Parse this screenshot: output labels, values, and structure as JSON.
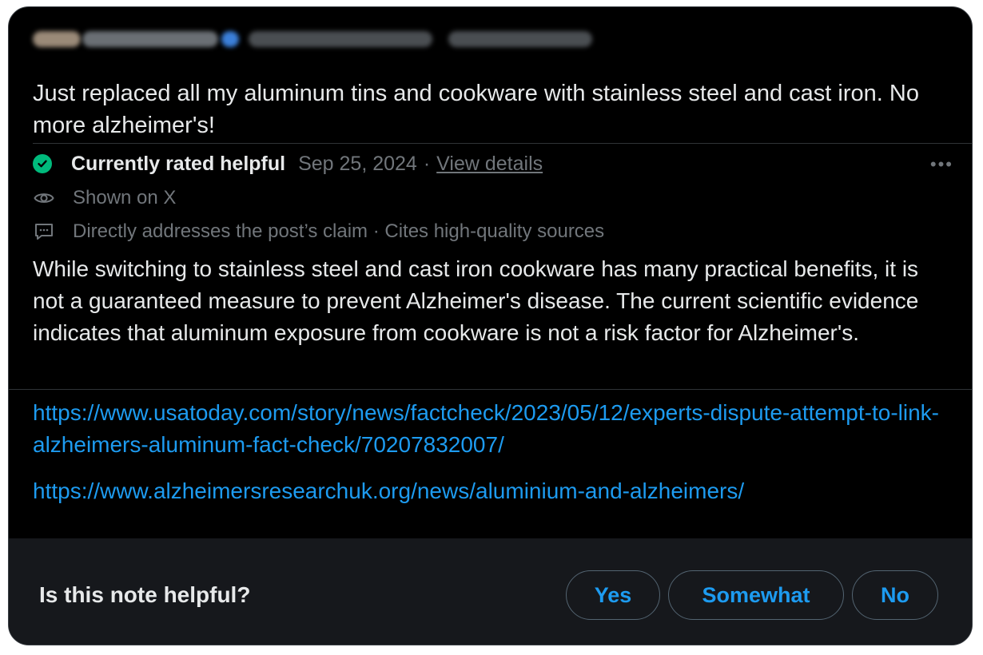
{
  "post": {
    "text": "Just replaced all my aluminum tins and cookware with stainless steel and cast iron. No more alzheimer's!"
  },
  "note": {
    "status": "Currently rated helpful",
    "date": "Sep 25, 2024",
    "separator": "·",
    "details_link": "View details",
    "more_icon": "more-horizontal-icon",
    "shown_on": "Shown on X",
    "qualities": "Directly addresses the post’s claim · Cites high-quality sources",
    "body": "While switching to stainless steel and cast iron cookware has many practical benefits, it is not a guaranteed measure to prevent Alzheimer's disease. The current scientific evidence indicates that aluminum exposure from cookware is not a risk factor for Alzheimer's.",
    "links": [
      "https://www.usatoday.com/story/news/factcheck/2023/05/12/experts-dispute-attempt-to-link-alzheimers-aluminum-fact-check/70207832007/",
      "https://www.alzheimersresearchuk.org/news/aluminium-and-alzheimers/"
    ]
  },
  "feedback": {
    "question": "Is this note helpful?",
    "yes": "Yes",
    "somewhat": "Somewhat",
    "no": "No"
  },
  "colors": {
    "background": "#000000",
    "text": "#e7e9ea",
    "muted": "#71767b",
    "link": "#1d9bf0",
    "helpful": "#00ba7c",
    "footer": "#16181c"
  }
}
